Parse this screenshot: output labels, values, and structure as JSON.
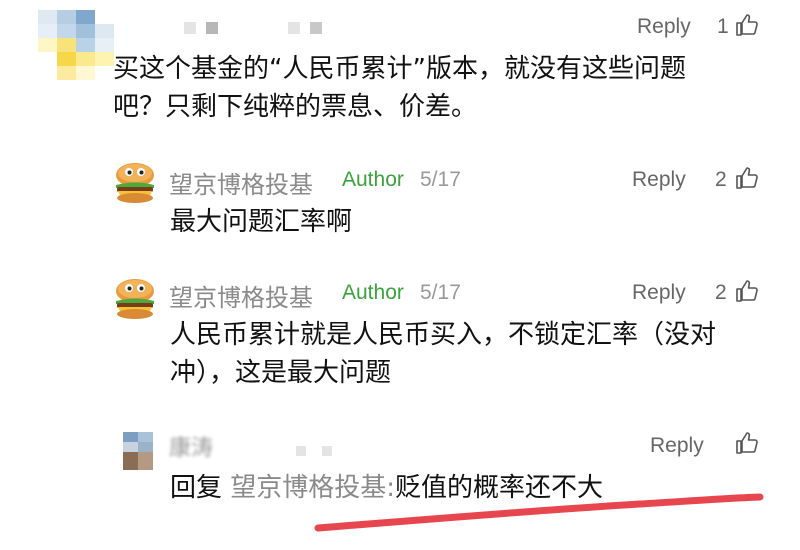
{
  "comments": [
    {
      "text_lines": [
        "买这个基金的“人民币累计”版本，就没有这些问题",
        "吧？只剩下纯粹的票息、价差。"
      ],
      "reply_label": "Reply",
      "likes": "1"
    },
    {
      "author": "望京博格投基",
      "author_tag": "Author",
      "date": "5/17",
      "text_lines": [
        "最大问题汇率啊"
      ],
      "reply_label": "Reply",
      "likes": "2"
    },
    {
      "author": "望京博格投基",
      "author_tag": "Author",
      "date": "5/17",
      "text_lines": [
        "人民币累计就是人民币买入，不锁定汇率（没对",
        "冲），这是最大问题"
      ],
      "reply_label": "Reply",
      "likes": "2"
    },
    {
      "author": "康涛",
      "reply_prefix": "回复",
      "reply_target": "望京博格投基:",
      "text": "贬值的概率还不大",
      "reply_label": "Reply"
    }
  ],
  "colors": {
    "author_tag": "#3aa33a",
    "underline": "#e8464f",
    "meta_text": "#999999"
  },
  "icons": [
    "thumbs-up-icon",
    "burger-avatar-icon",
    "pixelated-avatar"
  ]
}
